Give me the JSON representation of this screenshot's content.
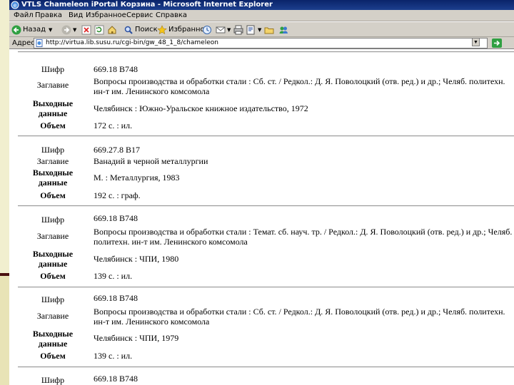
{
  "window": {
    "title": "VTLS Chameleon iPortal Корзина - Microsoft Internet Explorer"
  },
  "menu": [
    "Файл",
    "Правка",
    "Вид",
    "Избранное",
    "Сервис",
    "Справка"
  ],
  "toolbar": {
    "back_label": "Назад",
    "search_label": "Поиск",
    "favorites_label": "Избранное"
  },
  "address": {
    "label": "Адрес",
    "url": "http://virtua.lib.susu.ru/cgi-bin/gw_48_1_8/chameleon"
  },
  "labels": {
    "code": "Шифр",
    "title": "Заглавие",
    "imprint": "Выходные данные",
    "volume": "Объем"
  },
  "records": [
    {
      "code": "669.18 В748",
      "title": "Вопросы производства и обработки стали : Сб. ст. / Редкол.: Д. Я. Поволоцкий (отв. ред.) и др.; Челяб. политехн. ин-т им. Ленинского комсомола",
      "imprint": "Челябинск : Южно-Уральское книжное издательство, 1972",
      "volume": "172 с. : ил."
    },
    {
      "code": "669.27.8 В17",
      "title": "Ванадий в черной металлургии",
      "imprint": "М. : Металлургия, 1983",
      "volume": "192 с. : граф."
    },
    {
      "code": "669.18 В748",
      "title": "Вопросы производства и обработки стали : Темат. сб. науч. тр. / Редкол.: Д. Я. Поволоцкий (отв. ред.) и др.; Челяб. политехн. ин-т им. Ленинского комсомола",
      "imprint": "Челябинск : ЧПИ, 1980",
      "volume": "139 с. : ил."
    },
    {
      "code": "669.18 В748",
      "title": "Вопросы производства и обработки стали : Сб. ст. / Редкол.: Д. Я. Поволоцкий (отв. ред.) и др.; Челяб. политехн. ин-т им. Ленинского комсомола",
      "imprint": "Челябинск : ЧПИ, 1979",
      "volume": "139 с. : ил."
    },
    {
      "code": "669.18 В748"
    }
  ]
}
